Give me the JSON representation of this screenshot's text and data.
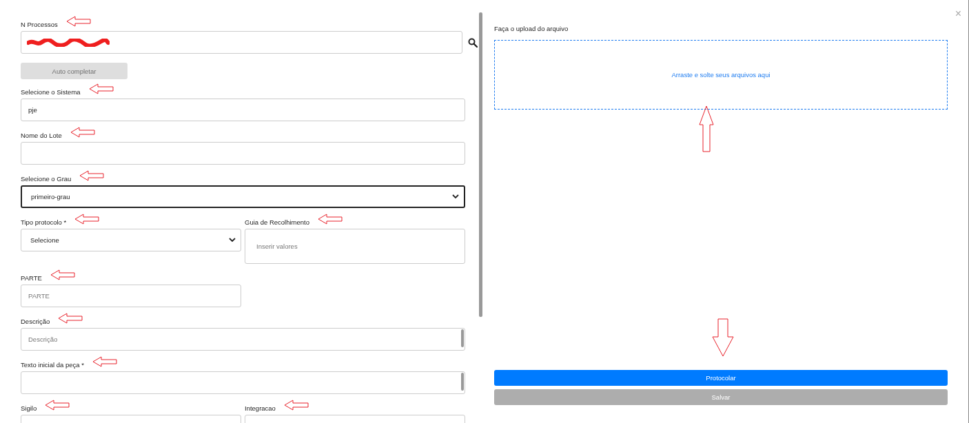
{
  "form": {
    "rows": [
      [
        {
          "kind": "search",
          "label": "N Processos",
          "arrow": true,
          "redacted": true
        }
      ],
      [
        {
          "kind": "button",
          "label": "Auto completar",
          "disabled": true
        }
      ],
      [
        {
          "kind": "text",
          "label": "Selecione o Sistema",
          "arrow": true,
          "value": "pje"
        }
      ],
      [
        {
          "kind": "text",
          "label": "Nome do Lote",
          "arrow": true
        }
      ],
      [
        {
          "kind": "select",
          "label": "Selecione o Grau",
          "arrow": true,
          "value": "primeiro-grau",
          "focused": true
        }
      ],
      [
        {
          "kind": "select",
          "label": "Tipo protocolo *",
          "arrow": true,
          "value": "Selecione"
        },
        {
          "kind": "tags",
          "label": "Guia de Recolhimento",
          "arrow": true,
          "placeholder": "Inserir valores"
        }
      ],
      [
        {
          "kind": "text",
          "label": "PARTE",
          "arrow": true,
          "placeholder": "PARTE",
          "half": true
        }
      ],
      [
        {
          "kind": "textarea",
          "label": "Descrição",
          "arrow": true,
          "placeholder": "Descrição"
        }
      ],
      [
        {
          "kind": "textarea",
          "label": "Texto inicial da peça *",
          "arrow": true
        }
      ],
      [
        {
          "kind": "select",
          "label": "Sigilo",
          "arrow": true
        },
        {
          "kind": "select",
          "label": "Integracao",
          "arrow": true
        }
      ]
    ]
  },
  "upload": {
    "title": "Faça o upload do arquivo",
    "dropzone": "Arraste e solte seus arquivos aqui",
    "arrow": true
  },
  "buttons": [
    {
      "label": "Protocolar",
      "kind": "primary",
      "arrow": true
    },
    {
      "label": "Salvar",
      "kind": "secondary",
      "arrow": false
    }
  ],
  "close": "×"
}
